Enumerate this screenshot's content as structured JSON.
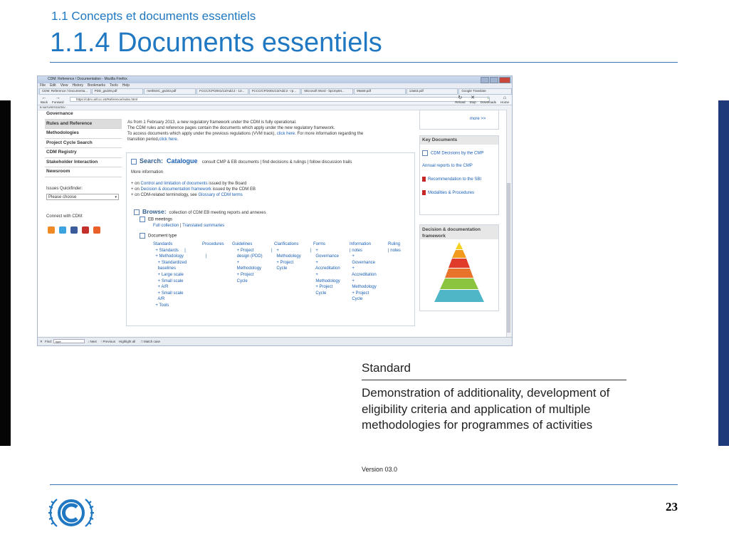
{
  "slide": {
    "subtitle": "1.1 Concepts et documents essentiels",
    "title": "1.1.4 Documents essentiels",
    "page_number": "23"
  },
  "browser": {
    "window_title": "CDM: Reference / Documentation - Mozilla Firefox",
    "menu": [
      "File",
      "Edit",
      "View",
      "History",
      "Bookmarks",
      "Tools",
      "Help"
    ],
    "tabs": [
      "CDM: Reference / Documenta...",
      "PDD_gsd49.pdf",
      "meth5SC_gsd43.pdf",
      "FCCC/CP/2001/13/Add.2 - 13...",
      "FCCC/CP/2001/13/Add.2 - rp...",
      "Microsoft Word - bpcmp84...",
      "09a59.pdf",
      "13a63.pdf",
      "Google Translate"
    ],
    "url": "https://cdm.unfccc.int/Reference/index.html",
    "back_label": "Back",
    "forward_label": "Forward",
    "reload_label": "Reload",
    "stop_label": "Stop",
    "downloads_label": "Downloads",
    "home_label": "Home",
    "bookmark": "B NATURESDATBV...",
    "find_label": "Find:",
    "find_value": "type",
    "find_next": "Next",
    "find_prev": "Previous",
    "find_highlight": "Highlight all",
    "find_match": "Match case"
  },
  "left_nav": {
    "items": [
      "Governance",
      "Rules and Reference",
      "Methodologies",
      "Project Cycle Search",
      "CDM Registry",
      "Stakeholder Interaction",
      "Newsroom"
    ],
    "quickfinder_label": "Issues Quickfinder:",
    "quickfinder_value": "Please choose",
    "connect_label": "Connect with CDM:"
  },
  "intro": {
    "line1": "As from 1 February 2013, a new regulatory framework under the CDM is fully operational.",
    "line2": "The CDM rules and reference pages contain the documents which apply under the new regulatory framework.",
    "line3_pre": "To access documents which apply under the previous regulations (VVM track),",
    "line3_link": "click here",
    "line3_post": ". For more information regarding the",
    "line4_pre": "transition period,",
    "line4_link": "click here",
    "line4_post": "."
  },
  "search": {
    "label": "Search:",
    "catalogue": "Catalogue",
    "desc": "consult CMP & EB documents | find decisions & rulings | follow discussion trails",
    "more_info": "More information",
    "on1_pre": "+ on",
    "on1_link": "Control and limitation of documents",
    "on1_post": "issued by the Board",
    "on2_pre": "+ on",
    "on2_link": "Decision & documentation framework",
    "on2_post": "issued by the CDM EB",
    "on3_pre": "+ on CDM-related terminology, see",
    "on3_link": "Glossary of CDM terms"
  },
  "browse": {
    "label": "Browse:",
    "desc": "collection of CDM EB meeting reports and annexes",
    "eb_meetings": "EB meetings",
    "full_collection": "Full collection",
    "sep": "|",
    "translated": "Translated summaries",
    "document_type": "Document type",
    "columns": [
      "Standards\n  + Standards     |\n  + Methodology\n    + Standardized\n    baselines\n    + Large scale\n    + Small scale\n    + A/R\n    + Small scale\n    A/R\n  + Tools",
      "Procedures\n\n   |",
      "Guidelines\n    + Project\n    design (PDD)\n    +\n    Methodology\n    + Project\n    Cycle",
      "\n|",
      "Clarifications\n  +\n  Methodology\n  + Project\n  Cycle",
      "\n|",
      "Forms\n  +\n  Governance\n  +\n  Accreditation\n  +\n  Methodology\n  + Project\n  Cycle",
      "Information\n| notes\n  +\n  Governance\n  +\n  Accreditation\n  +\n  Methodology\n  + Project\n  Cycle",
      "Ruling\n| notes"
    ]
  },
  "right_col": {
    "more": "more >>",
    "key_docs_head": "Key Documents",
    "key_docs": [
      "CDM Decisions by the CMP",
      "Annual reports to the CMP",
      "Recommendation to the SBI",
      "Modalities & Procedures"
    ],
    "framework_head": "Decision & documentation framework"
  },
  "standard": {
    "label": "Standard",
    "body": "Demonstration of additionality, development of eligibility criteria and application of multiple methodologies for programmes of activities",
    "version": "Version 03.0"
  },
  "colors": {
    "accent": "#1f78c1",
    "link": "#1a5fb4",
    "right_bar": "#1e3a78"
  }
}
